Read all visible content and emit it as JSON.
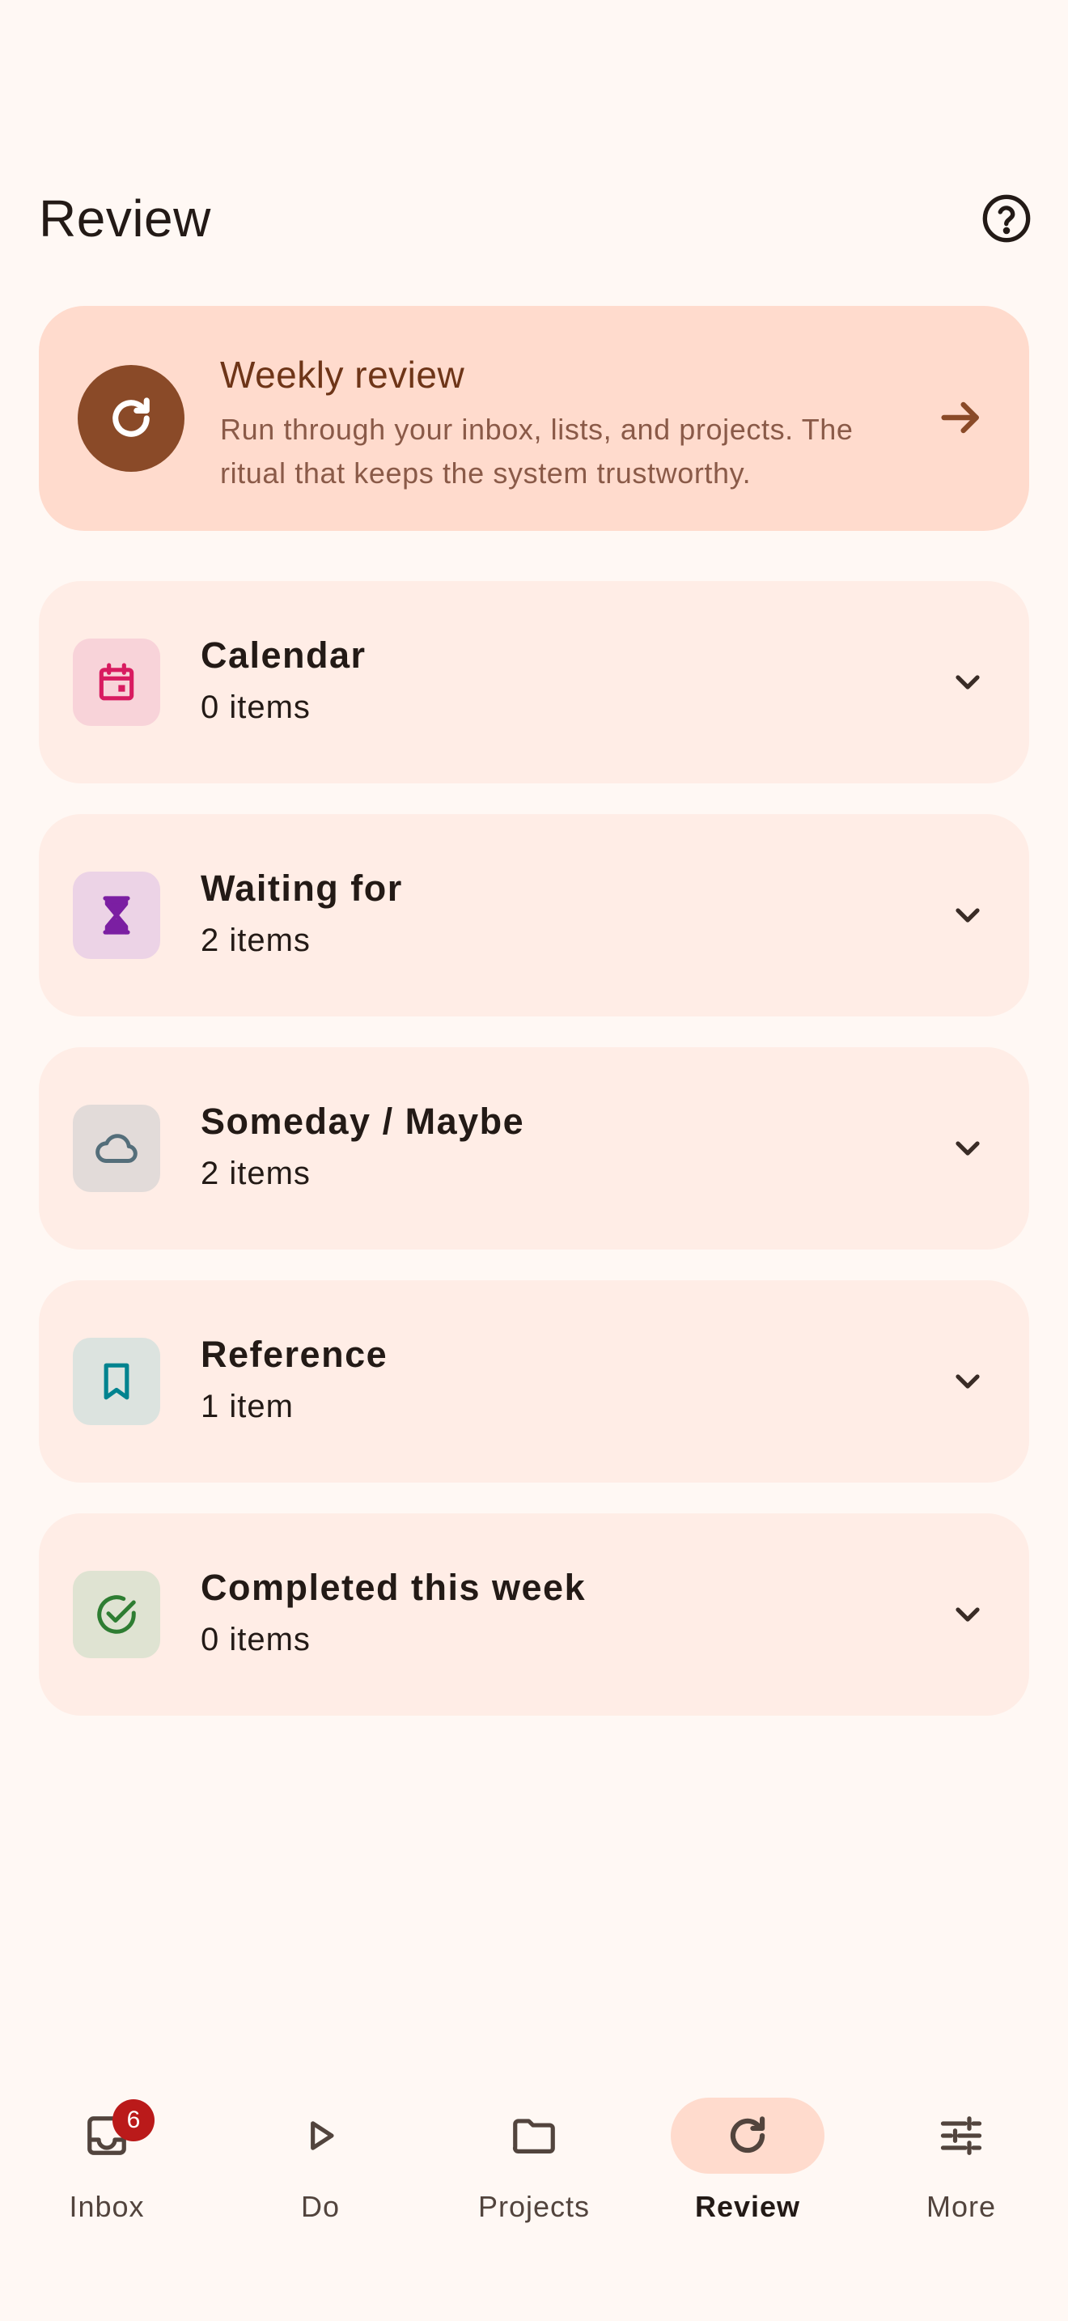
{
  "header": {
    "title": "Review"
  },
  "weekly_review": {
    "title": "Weekly review",
    "subtitle_line1": "Run through your inbox, lists, and projects. The",
    "subtitle_line2": "ritual that keeps the system trustworthy."
  },
  "categories": [
    {
      "title": "Calendar",
      "count": "0 items",
      "icon": "calendar-icon",
      "color": "#D81B60",
      "bg": "#F8D3D9"
    },
    {
      "title": "Waiting for",
      "count": "2 items",
      "icon": "hourglass-icon",
      "color": "#7B1FA2",
      "bg": "#ECD3E6"
    },
    {
      "title": "Someday / Maybe",
      "count": "2 items",
      "icon": "cloud-icon",
      "color": "#546E7A",
      "bg": "#E2DBD9"
    },
    {
      "title": "Reference",
      "count": "1 item",
      "icon": "bookmark-icon",
      "color": "#00838F",
      "bg": "#DCE3DF"
    },
    {
      "title": "Completed this week",
      "count": "0 items",
      "icon": "check-circle-icon",
      "color": "#2E7D32",
      "bg": "#DFE3D2"
    }
  ],
  "nav": [
    {
      "label": "Inbox",
      "icon": "inbox-icon",
      "badge": "6",
      "active": false
    },
    {
      "label": "Do",
      "icon": "play-icon",
      "active": false
    },
    {
      "label": "Projects",
      "icon": "folder-icon",
      "active": false
    },
    {
      "label": "Review",
      "icon": "refresh-icon",
      "active": true
    },
    {
      "label": "More",
      "icon": "tune-icon",
      "active": false
    }
  ],
  "colors": {
    "accent": "#8A4A28",
    "card": "#FFEDE6",
    "highlight": "#FFDBCD",
    "background": "#FFF8F4",
    "badge": "#BA1A1A"
  }
}
